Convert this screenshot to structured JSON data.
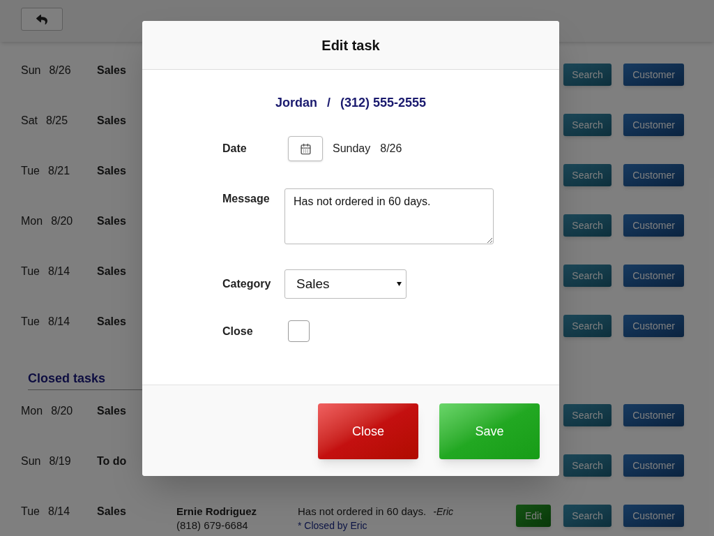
{
  "open_tasks": [
    {
      "day": "Sun",
      "date": "8/26",
      "category": "Sales",
      "search_button": "Search",
      "customer_button": "Customer"
    },
    {
      "day": "Sat",
      "date": "8/25",
      "category": "Sales",
      "search_button": "Search",
      "customer_button": "Customer"
    },
    {
      "day": "Tue",
      "date": "8/21",
      "category": "Sales",
      "search_button": "Search",
      "customer_button": "Customer"
    },
    {
      "day": "Mon",
      "date": "8/20",
      "category": "Sales",
      "search_button": "Search",
      "customer_button": "Customer"
    },
    {
      "day": "Tue",
      "date": "8/14",
      "category": "Sales",
      "search_button": "Search",
      "customer_button": "Customer"
    },
    {
      "day": "Tue",
      "date": "8/14",
      "category": "Sales",
      "search_button": "Search",
      "customer_button": "Customer"
    }
  ],
  "closed_heading": "Closed tasks",
  "closed_tasks": [
    {
      "day": "Mon",
      "date": "8/20",
      "category": "Sales",
      "search_button": "Search",
      "customer_button": "Customer"
    },
    {
      "day": "Sun",
      "date": "8/19",
      "category": "To do",
      "search_button": "Search",
      "customer_button": "Customer"
    },
    {
      "day": "Tue",
      "date": "8/14",
      "category": "Sales",
      "name": "Ernie Rodriguez",
      "phone": "(818) 679-6684",
      "message": "Has not ordered in 60 days.",
      "author": "-Eric",
      "note": "* Closed by Eric",
      "edit_button": "Edit",
      "search_button": "Search",
      "customer_button": "Customer"
    }
  ],
  "dialog": {
    "title": "Edit task",
    "contact_name": "Jordan",
    "separator": "/",
    "contact_phone": "(312) 555-2555",
    "date_label": "Date",
    "date_day": "Sunday",
    "date_value": "8/26",
    "message_label": "Message",
    "message": "Has not ordered in 60 days.",
    "category_label": "Category",
    "category": "Sales",
    "close_label": "Close",
    "close_checked": false,
    "close_button": "Close",
    "save_button": "Save"
  }
}
